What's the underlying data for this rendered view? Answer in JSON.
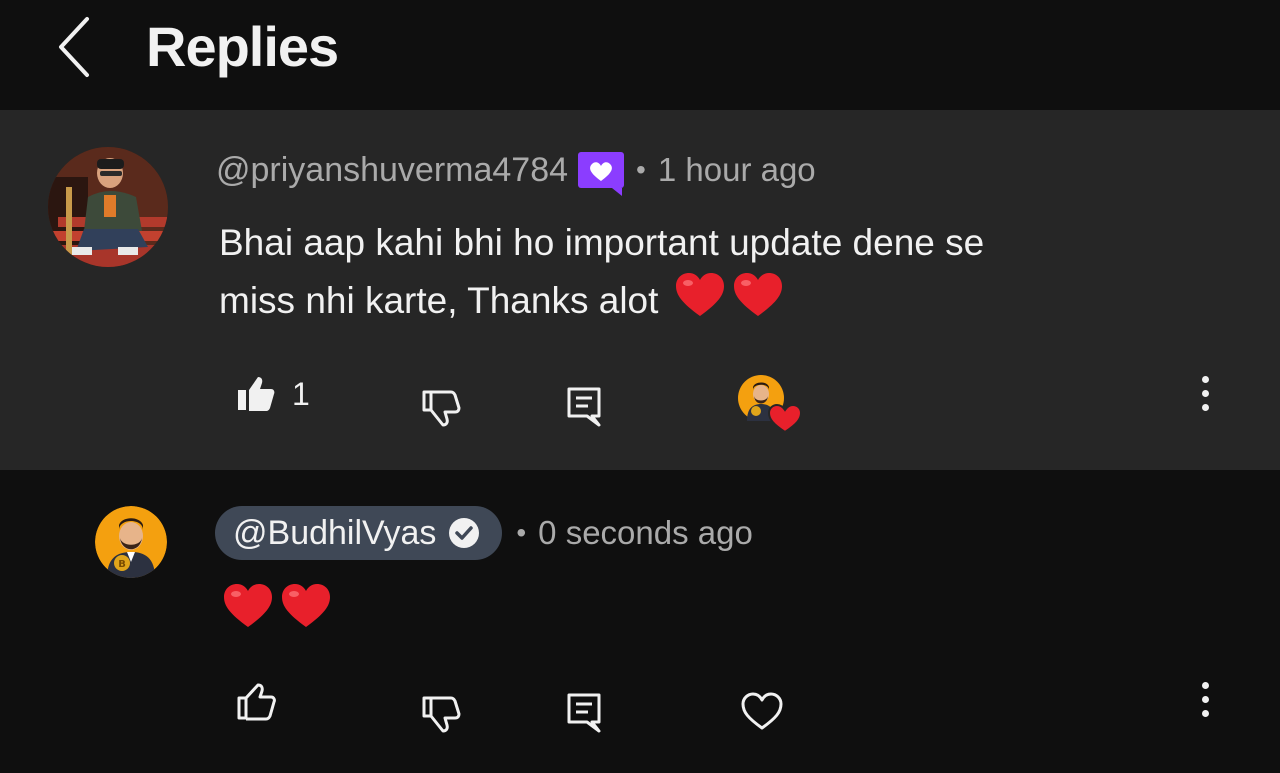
{
  "header": {
    "title": "Replies",
    "back_icon": "chevron-left-icon"
  },
  "parent_comment": {
    "handle": "@priyanshuverma4784",
    "badge": "member-badge-heart-icon",
    "separator": "•",
    "time": "1 hour ago",
    "text_line1": "Bhai aap kahi bhi ho important update dene se",
    "text_line2": "miss nhi karte, Thanks alot",
    "emoji": [
      "red-heart",
      "red-heart"
    ],
    "like_count": "1",
    "creator_heart": "creator-heart-icon"
  },
  "reply": {
    "handle": "@BudhilVyas",
    "verified": "verified-check-icon",
    "separator": "•",
    "time": "0 seconds ago",
    "emoji": [
      "red-heart",
      "red-heart"
    ]
  },
  "colors": {
    "background": "#0f0f0f",
    "highlight": "#262626",
    "secondary_text": "#aaaaaa",
    "member_badge": "#8b3dff",
    "creator_pill": "#3f4856",
    "heart": "#e8202b"
  }
}
